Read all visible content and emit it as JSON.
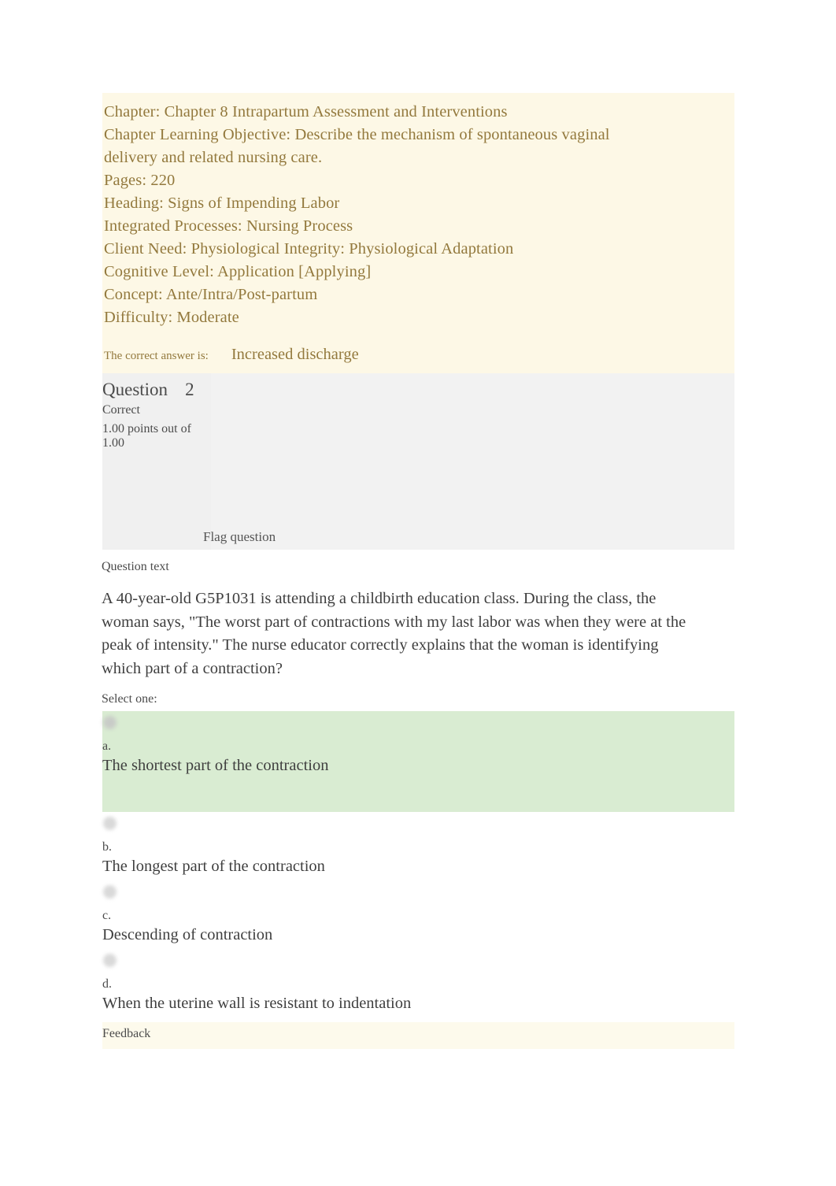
{
  "rationale": {
    "lines": [
      "Chapter: Chapter 8 Intrapartum Assessment and Interventions",
      "Chapter Learning Objective: Describe the mechanism of spontaneous vaginal",
      "delivery and related nursing care.",
      "Pages: 220",
      "Heading: Signs of Impending Labor",
      "Integrated Processes: Nursing Process",
      "Client Need: Physiological Integrity: Physiological Adaptation",
      "Cognitive Level: Application [Applying]",
      "Concept: Ante/Intra/Post-partum",
      "Difficulty: Moderate"
    ],
    "correct_answer_label": "The correct answer is:",
    "correct_answer_value": "Increased discharge",
    "background_color": "#fdf8e6",
    "text_color": "#93793d"
  },
  "question": {
    "title_word": "Question",
    "number": "2",
    "status": "Correct",
    "points": "1.00 points out of 1.00",
    "flag_label": "Flag question",
    "question_text_label": "Question text",
    "stem": "A 40-year-old G5P1031 is attending a childbirth education class. During the class, the woman says, \"The worst part of contractions with my last labor was when they were at the peak of intensity.\" The nurse educator correctly explains that the woman is identifying which part of a contraction?",
    "select_one_label": "Select one:",
    "header_background_color": "#f2f2f2"
  },
  "answers": {
    "options": [
      {
        "letter": "a.",
        "text": "The shortest part of the contraction",
        "highlighted": true,
        "highlight_color": "#d9ecd2"
      },
      {
        "letter": "b.",
        "text": "The longest part of the contraction",
        "highlighted": false,
        "highlight_color": ""
      },
      {
        "letter": "c.",
        "text": "Descending of contraction",
        "highlighted": false,
        "highlight_color": ""
      },
      {
        "letter": "d.",
        "text": "When the uterine wall is resistant to indentation",
        "highlighted": false,
        "highlight_color": ""
      }
    ]
  },
  "feedback": {
    "label": "Feedback",
    "background_color": "#fdfaec"
  }
}
